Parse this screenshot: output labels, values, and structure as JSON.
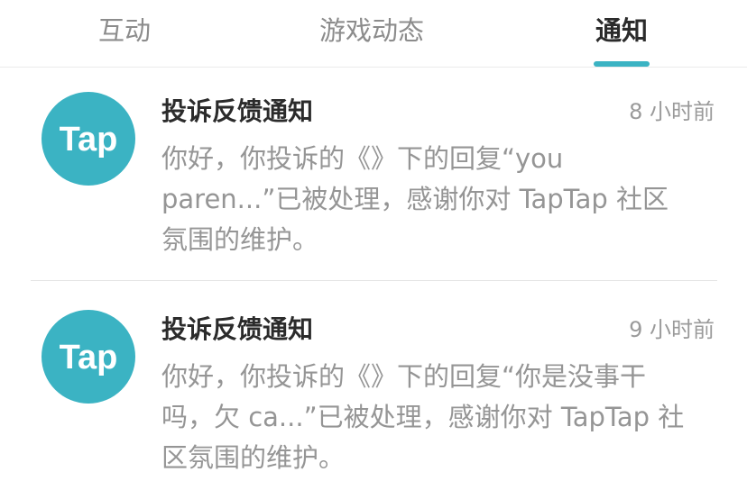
{
  "tabs": {
    "interaction": "互动",
    "game_news": "游戏动态",
    "notifications": "通知"
  },
  "brand": {
    "avatar_text": "Tap",
    "accent_color": "#3bb3c3"
  },
  "notifications": [
    {
      "title": "投诉反馈通知",
      "time": "8 小时前",
      "body_lines": [
        "你好，你投诉的《》下的回复“you",
        "paren...”已被处理，感谢你对 TapTap 社区",
        "氛围的维护。"
      ]
    },
    {
      "title": "投诉反馈通知",
      "time": "9 小时前",
      "body_lines": [
        "你好，你投诉的《》下的回复“你是没事干",
        "吗，欠 ca...”已被处理，感谢你对 TapTap 社",
        "区氛围的维护。"
      ]
    }
  ]
}
